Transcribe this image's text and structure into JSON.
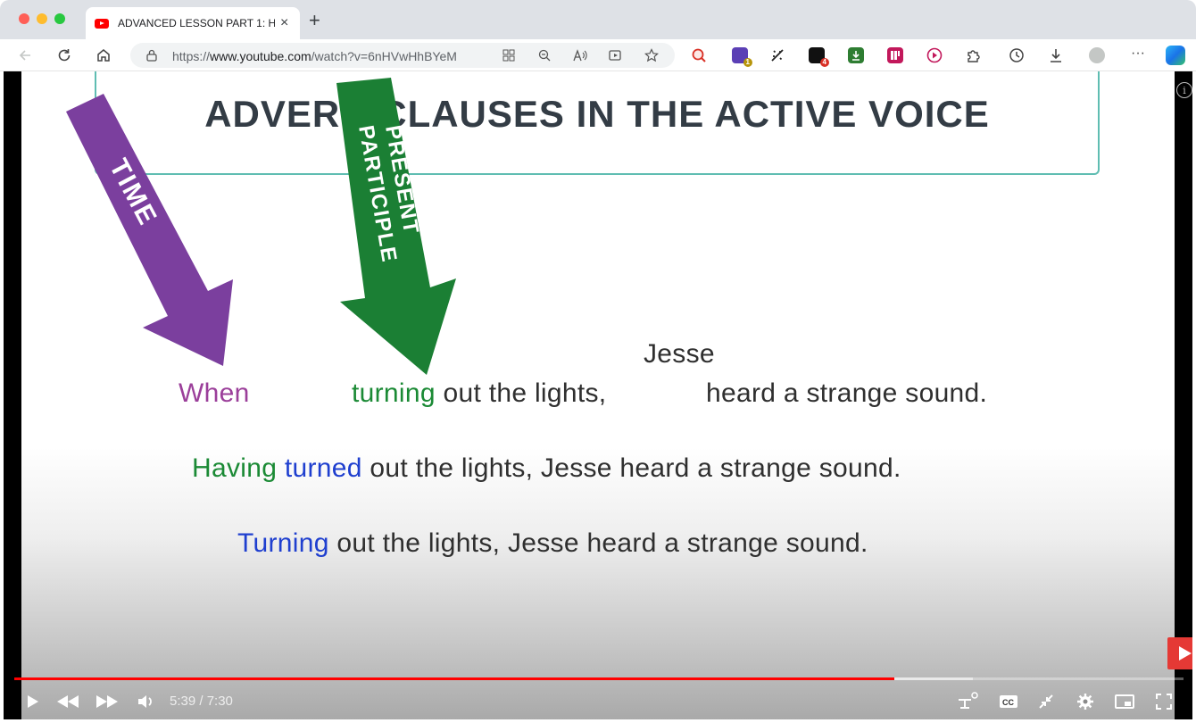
{
  "browser": {
    "tab_title": "ADVANCED LESSON PART 1: H",
    "tab_close": "×",
    "new_tab": "+",
    "url_scheme": "https://",
    "url_host": "www.youtube.com",
    "url_path": "/watch?v=6nHVwHhBYeM",
    "ext_badges": {
      "first": "1",
      "second": "4"
    },
    "more_menu": "···"
  },
  "slide": {
    "title": "ADVERB CLAUSES IN THE ACTIVE VOICE",
    "arrow_time_label": "TIME",
    "arrow_participle_label_1": "PRESENT",
    "arrow_participle_label_2": "PARTICIPLE",
    "line1_subject": "Jesse",
    "line1_when": "When",
    "line1_turning": "turning",
    "line1_rest": "out the lights,",
    "line1_end": "heard a strange sound.",
    "line2_having": "Having",
    "line2_turned": "turned",
    "line2_rest": "out the lights, Jesse heard a strange sound.",
    "line3_turning": "Turning",
    "line3_rest": "out the lights, Jesse heard a strange sound.",
    "info_icon": "i"
  },
  "player": {
    "time_display": "5:39 / 7:30",
    "progress_played": 0.753,
    "progress_loaded": 0.82,
    "colors": {
      "played": "#ff0000",
      "endcard": "#e53935"
    }
  },
  "colors": {
    "time_arrow": "#7b3f9e",
    "participle_arrow": "#1b7f34",
    "title_border": "#5fbdb2"
  }
}
